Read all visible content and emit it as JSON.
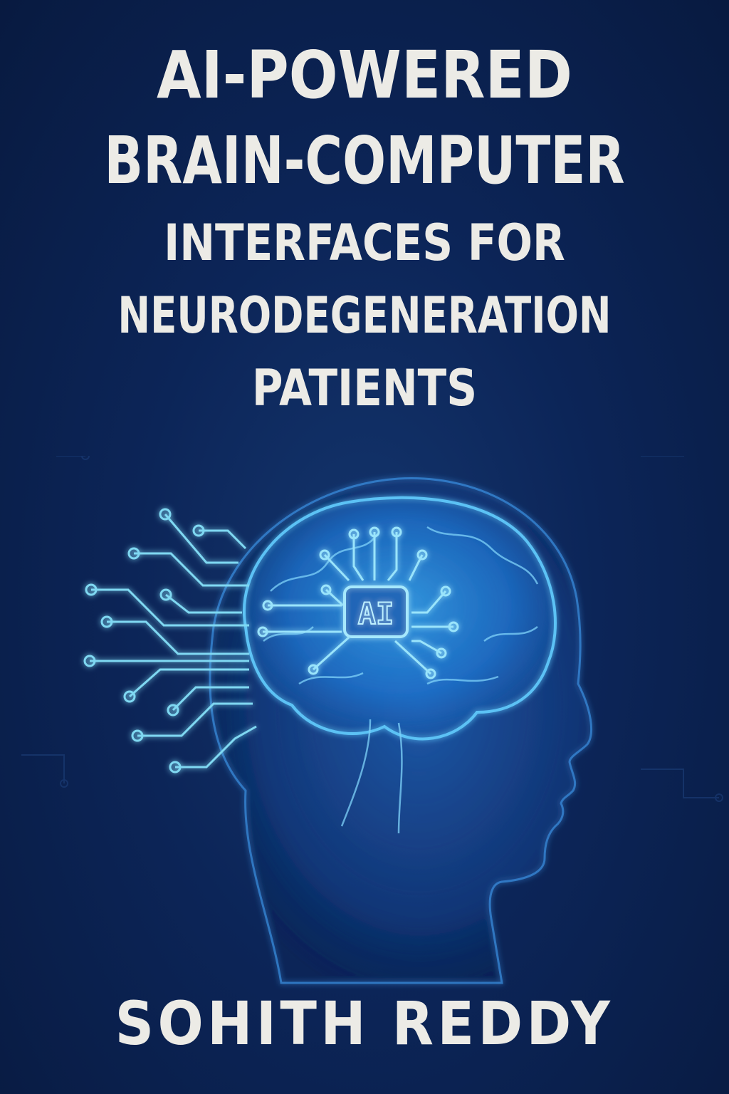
{
  "book": {
    "title_lines": [
      "AI-POWERED",
      "BRAIN-COMPUTER",
      "INTERFACES FOR",
      "NEURODEGENERATION",
      "PATIENTS"
    ],
    "chip_label": "AI",
    "author": "SOHITH REDDY"
  },
  "colors": {
    "background": "#0a1f4a",
    "title_text": "#ecebe6",
    "circuit_glow": "#7fd8f2",
    "brain_glow": "#2f9be6"
  },
  "icons": {
    "illustration": "head-profile-with-glowing-brain-and-circuit-lines",
    "chip": "ai-chip-icon"
  }
}
